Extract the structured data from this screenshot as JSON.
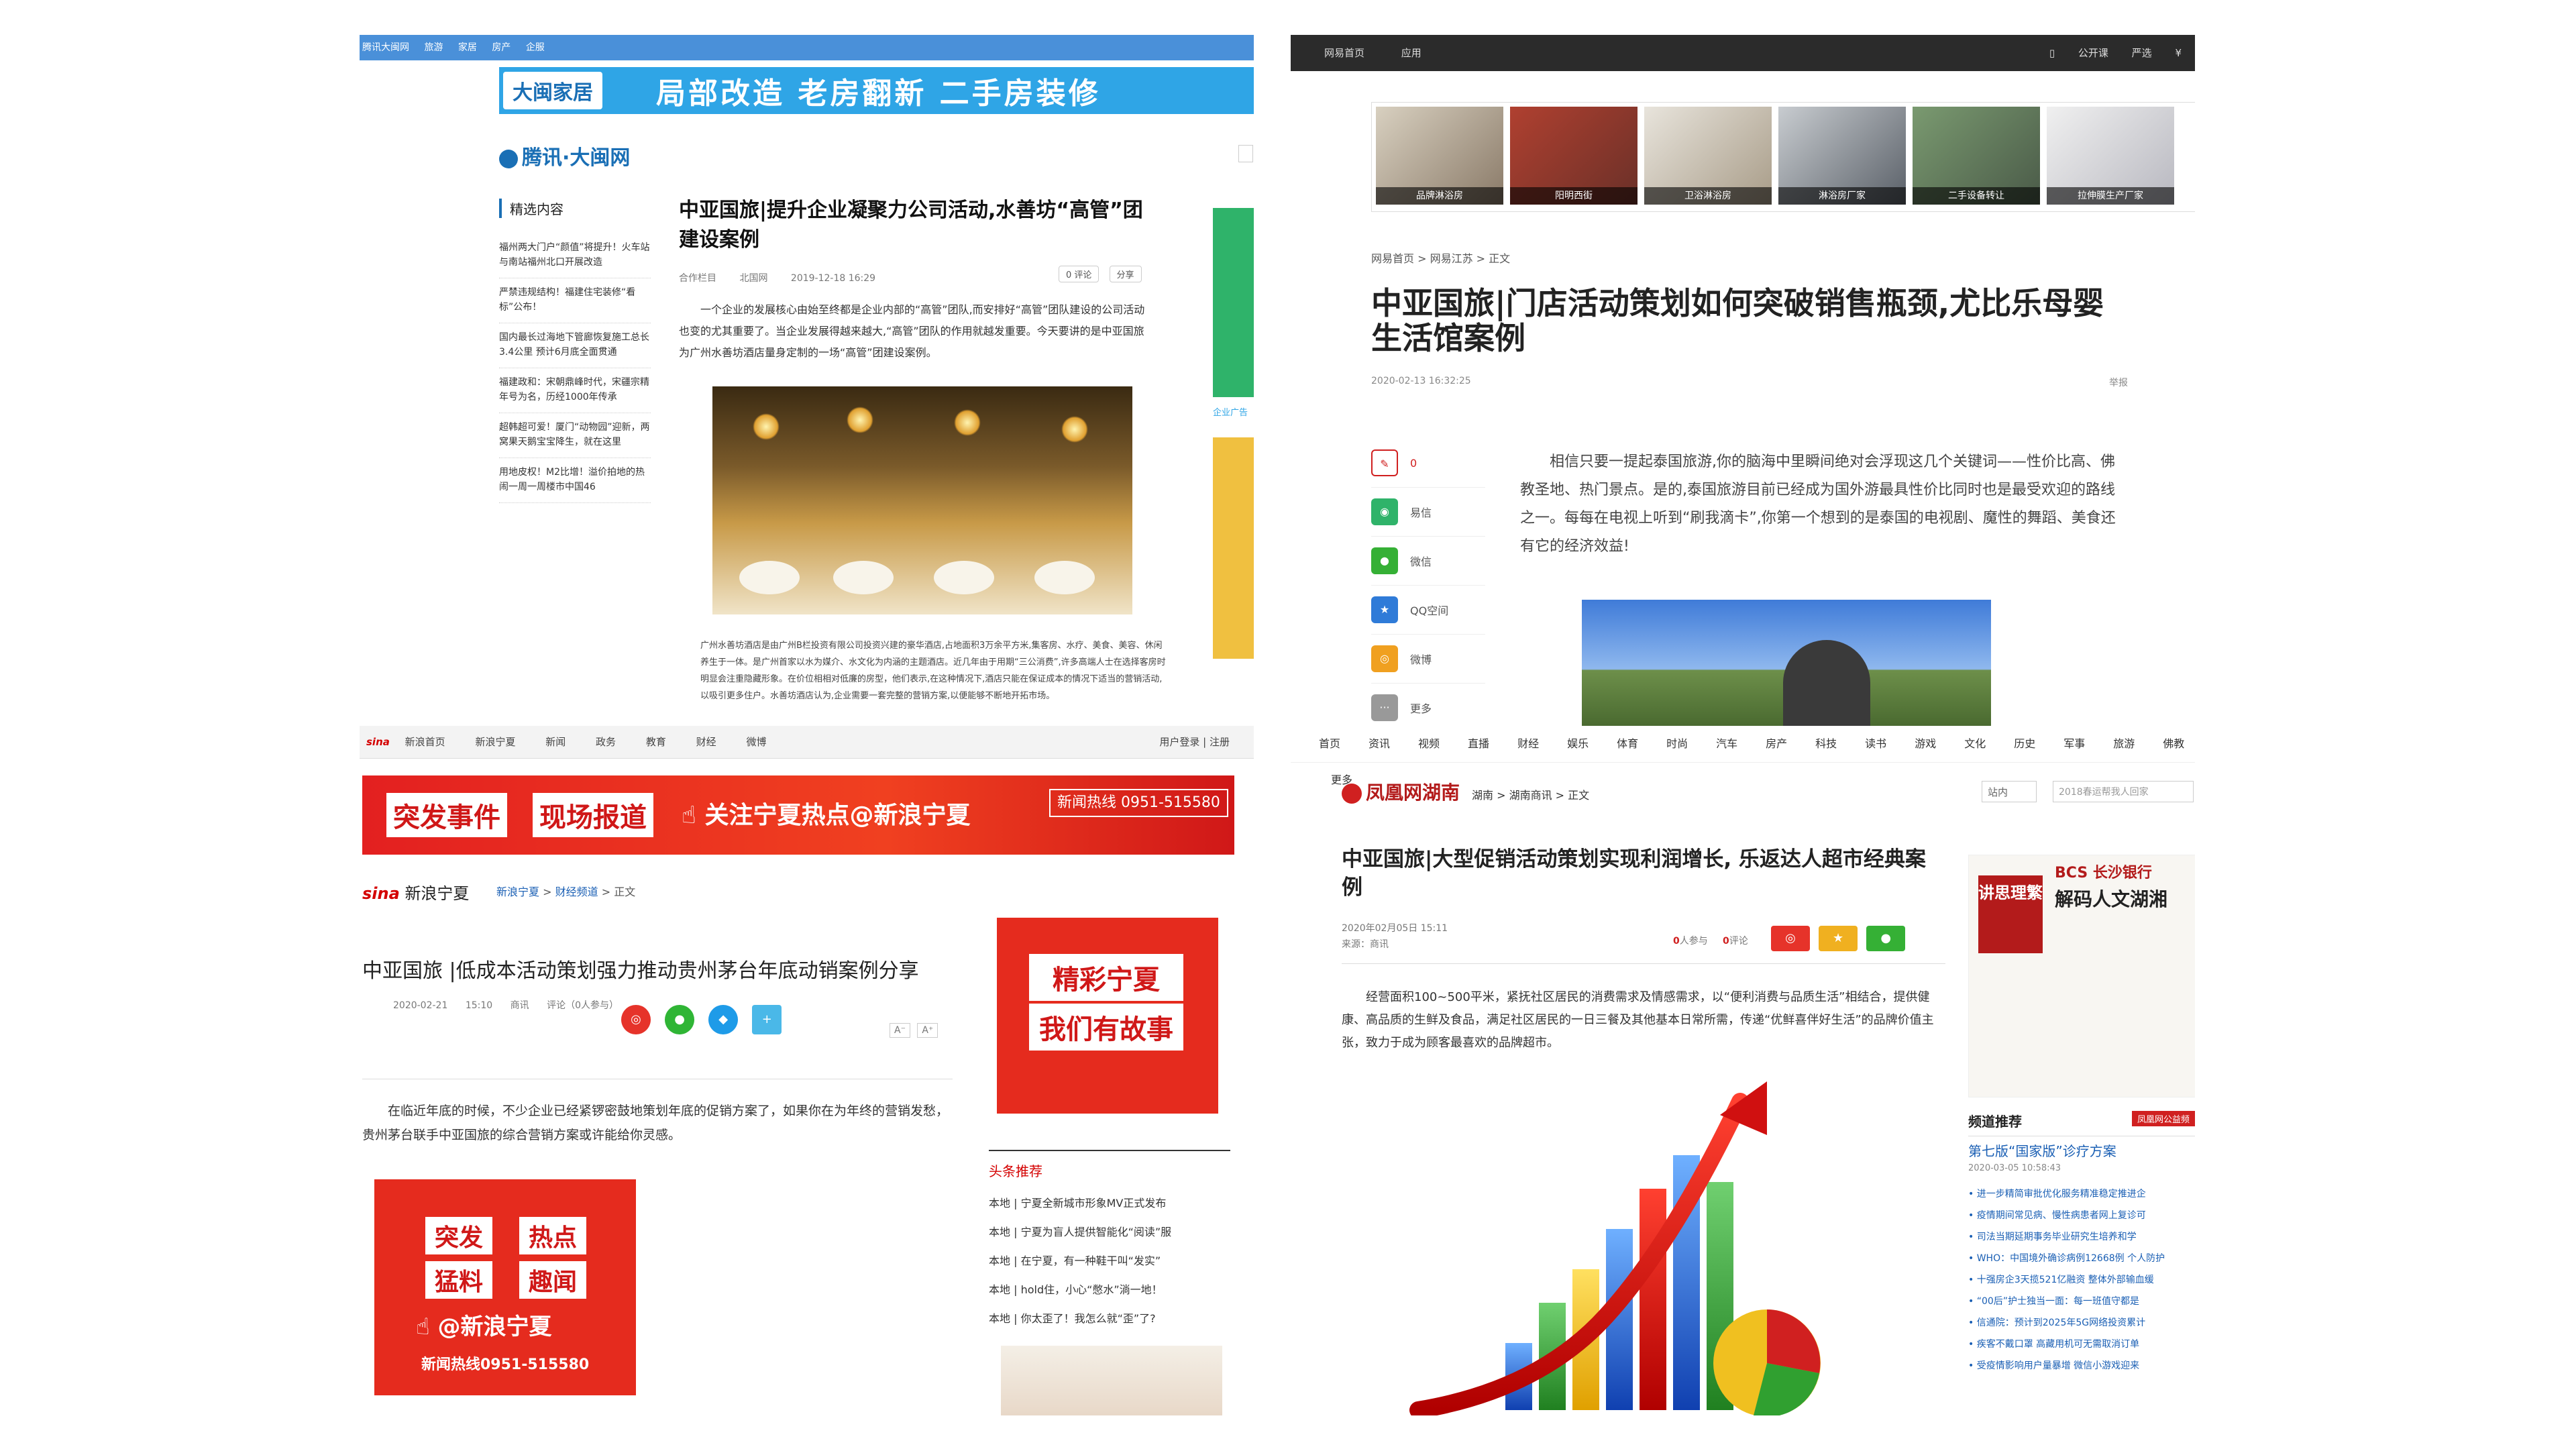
{
  "colors": {
    "tencent_blue": "#1a6fb5",
    "netease_dark": "#2b2b2b",
    "sina_red": "#e32020",
    "ifeng_red": "#b31b1b",
    "link_blue": "#1a5fb4"
  },
  "tencent": {
    "topbar": [
      "腾讯大闽网",
      "旅游",
      "家居",
      "房产",
      "企服"
    ],
    "banner_logo": "大闽家居",
    "banner_slogan": "局部改造 老房翻新 二手房装修",
    "brand": "腾讯·大闽网",
    "side_title": "精选内容",
    "side_items": [
      "福州两大门户“颜值”将提升！火车站与南站福州北口开展改造",
      "严禁违规结构！福建住宅装修“看标”公布！",
      "国内最长过海地下管廊恢复施工总长3.4公里 预计6月底全面贯通",
      "福建政和：宋朝鼎峰时代，宋疆宗精年号为名，历经1000年传承",
      "超韩超可爱！厦门“动物园”迎新，两窝果天鹅宝宝降生，就在这里",
      "用地皮权！M2比增！溢价拍地的热闹一周一周楼市中国46"
    ],
    "title": "中亚国旅|提升企业凝聚力公司活动,水善坊“高管”团建设案例",
    "meta": [
      "合作栏目",
      "北国网",
      "2019-12-18 16:29"
    ],
    "btn_comment": "0 评论",
    "btn_share": "分享",
    "intro": "一个企业的发展核心由始至终都是企业内部的“高管”团队,而安排好“高管”团队建设的公司活动也变的尤其重要了。当企业发展得越来越大,“高管”团队的作用就越发重要。今天要讲的是中亚国旅为广州水善坊酒店量身定制的一场“高管”团建设案例。",
    "caption": "广州水善坊酒店是由广州B栏投资有限公司投资兴建的豪华酒店,占地面积3万余平方米,集客房、水疗、美食、美容、休闲养生于一体。是广州首家以水为媒介、水文化为内涵的主题酒店。近几年由于用期“三公消费”,许多高端人士在选择客房时明显会注重隐藏形象。在价位相相对低廉的房型，他们表示,在这种情况下,酒店只能在保证成本的情况下适当的营销活动,以吸引更多住户。水善坊酒店认为,企业需要一套完整的营销方案,以便能够不断地开拓市场。",
    "right_ad_text": "企业广告"
  },
  "netease": {
    "topbar_left": [
      "网易首页",
      "应用"
    ],
    "topbar_right": [
      "公开课",
      "严选",
      "¥"
    ],
    "ads": [
      "品牌淋浴房",
      "阳明西街",
      "卫浴淋浴房",
      "淋浴房厂家",
      "二手设备转让",
      "拉伸膜生产厂家"
    ],
    "crumb": "网易首页 > 网易江苏 > 正文",
    "title": "中亚国旅|门店活动策划如何突破销售瓶颈,尤比乐母婴生活馆案例",
    "date": "2020-02-13 16:32:25",
    "report": "举报",
    "share": [
      {
        "label": "0",
        "color": "#d02020"
      },
      {
        "label": "易信",
        "color": "#2fb36a"
      },
      {
        "label": "微信",
        "color": "#35b035"
      },
      {
        "label": "QQ空间",
        "color": "#2f7bd8"
      },
      {
        "label": "微博",
        "color": "#f0a020"
      },
      {
        "label": "更多",
        "color": "#999999"
      }
    ],
    "para": "相信只要一提起泰国旅游,你的脑海中里瞬间绝对会浮现这几个关键词——性价比高、佛教圣地、热门景点。是的,泰国旅游目前已经成为国外游最具性价比同时也是最受欢迎的路线之一。每每在电视上听到“刷我滴卡”,你第一个想到的是泰国的电视剧、魔性的舞蹈、美食还有它的经济效益!"
  },
  "sina": {
    "nav_logo": "sina",
    "nav": [
      "新浪首页",
      "新浪宁夏",
      "新闻",
      "政务",
      "教育",
      "财经",
      "微博"
    ],
    "nav_right": [
      "用户登录",
      "注册"
    ],
    "banner_boxes": [
      "突发事件",
      "现场报道"
    ],
    "banner_text": "关注宁夏热点@新浪宁夏",
    "banner_hotline": "新闻热线 0951-515580",
    "brand": "新浪宁夏",
    "crumb_links": [
      "新浪宁夏",
      "财经频道"
    ],
    "crumb_end": "正文",
    "title": "中亚国旅 |低成本活动策划强力推动贵州茅台年底动销案例分享",
    "meta": [
      "2020-02-21",
      "15:10",
      "商讯",
      "评论（0人参与）"
    ],
    "font_label": "A",
    "para": "在临近年底的时候，不少企业已经紧锣密鼓地策划年底的促销方案了，如果你在为年终的营销发愁，贵州茅台联手中亚国旅的综合营销方案或许能给你灵感。",
    "img_boxes": [
      "突发",
      "热点",
      "猛料",
      "趣闻"
    ],
    "img_at": "@新浪宁夏",
    "img_line": "新闻热线0951-515580",
    "right_ad": [
      "精彩宁夏",
      "我们有故事"
    ],
    "right_title": "头条推荐",
    "right_list": [
      "本地 | 宁夏全新城市形象MV正式发布",
      "本地 | 宁夏为盲人提供智能化“阅读”服",
      "本地 | 在宁夏，有一种鞋干叫“发实”",
      "本地 | hold住，小心“憋水”淌一地！",
      "本地 | 你太歪了！我怎么就“歪”了?"
    ]
  },
  "ifeng": {
    "nav": [
      "首页",
      "资讯",
      "视频",
      "直播",
      "财经",
      "娱乐",
      "体育",
      "时尚",
      "汽车",
      "房产",
      "科技",
      "读书",
      "游戏",
      "文化",
      "历史",
      "军事",
      "旅游",
      "佛教",
      "更多"
    ],
    "logo": "凤凰网湖南",
    "crumb": "湖南 > 湖南商讯 > 正文",
    "search_select": "站内",
    "search_placeholder": "2018春运帮我人回家",
    "title": "中亚国旅|大型促销活动策划实现利润增长, 乐返达人超市经典案例",
    "date": "2020年02月05日 15:11",
    "source": "来源：商讯",
    "participants": "0",
    "participants_label": "人参与",
    "comments": "0",
    "comments_label": "评论",
    "para": "经营面积100~500平米，紧抚社区居民的消费需求及情感需求，以“便利消费与品质生活”相结合，提供健康、高品质的生鲜及食品，满足社区居民的一日三餐及其他基本日常所需，传递“优鲜喜伴好生活”的品牌价值主张，致力于成为顾客最喜欢的品牌超市。",
    "right_ad_bcs": "BCS 长沙银行",
    "right_ad_title": "解码人文湖湘",
    "right_ad_seal": "讲思理繁",
    "right_title": "频道推荐",
    "right_tag": "凤凰网公益频",
    "right_head": "第七版“国家版”诊疗方案",
    "right_date": "2020-03-05 10:58:43",
    "right_list": [
      "进一步精简审批优化服务精准稳定推进企",
      "疫情期间常见病、慢性病患者网上复诊可",
      "司法当期延期事务毕业研究生培养和学",
      "WHO：中国境外确诊病例12668例 个人防护",
      "十强房企3天揽521亿融资 整体外部输血缓",
      "“00后”护士独当一面：每一班值守都是",
      "信通院：预计到2025年5G网络投资累计",
      "疾客不戴口罩 高藏用机可无需取消订单",
      "受疫情影响用户量暴增 微信小游戏迎来"
    ]
  }
}
